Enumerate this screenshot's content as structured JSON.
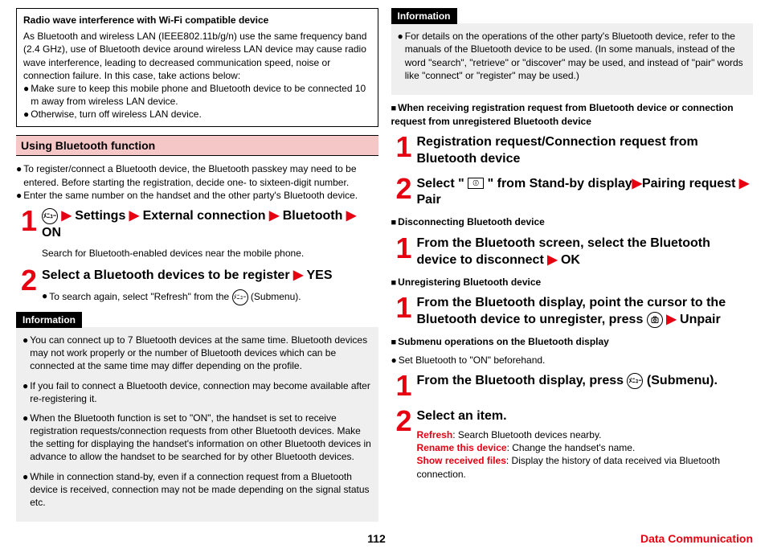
{
  "left": {
    "box": {
      "title": "Radio wave interference with Wi-Fi compatible device",
      "p1": "As Bluetooth and wireless LAN (IEEE802.11b/g/n) use the same frequency band (2.4 GHz), use of Bluetooth device around wireless LAN device may cause radio wave interference, leading to decreased communication speed, noise or connection failure. In this case, take actions below:",
      "b1": "Make sure to keep this mobile phone and Bluetooth device to be connected 10 m away from wireless LAN device.",
      "b2": "Otherwise, turn off wireless LAN device."
    },
    "section": "Using Bluetooth function",
    "pre1": "To register/connect a Bluetooth device, the Bluetooth passkey may need to be entered. Before starting the registration, decide one- to sixteen-digit number.",
    "pre2": "Enter the same number on the handset and the other party's Bluetooth device.",
    "step1": {
      "menu_icon": "ﾒﾆｭｰ",
      "a": "Settings",
      "b": "External connection",
      "c": "Bluetooth",
      "d": "ON",
      "note": "Search for Bluetooth-enabled devices near the mobile phone."
    },
    "step2": {
      "heading_a": "Select a Bluetooth devices to be register",
      "heading_b": "YES",
      "note": "To search again, select \"Refresh\" from the",
      "submenu_icon": "ﾒﾆｭｰ",
      "note_tail": "(Submenu)."
    },
    "info_label": "Information",
    "info": {
      "i1": "You can connect up to 7 Bluetooth devices at the same time. Bluetooth devices may not work properly or the number of Bluetooth devices which can be connected at the same time may differ depending on the profile.",
      "i2": "If you fail to connect a Bluetooth device, connection may become available after re-registering it.",
      "i3": "When the Bluetooth function is set to \"ON\", the handset is set to receive registration requests/connection requests from other Bluetooth devices. Make the setting for displaying the handset's information on other Bluetooth devices in advance to allow the handset to be searched for by other Bluetooth devices.",
      "i4": "While in connection stand-by, even if a connection request from a Bluetooth device is received, connection may not be made depending on the signal status etc."
    }
  },
  "right": {
    "info_label": "Information",
    "info1": "For details on the operations of the other party's Bluetooth device, refer to the manuals of the Bluetooth device to be used. (In some manuals, instead of the word \"search\", \"retrieve\" or \"discover\" may be used, and instead of \"pair\" words like \"connect\" or \"register\" may be used.)",
    "h1": "When receiving registration request from Bluetooth device or connection request from unregistered Bluetooth device",
    "step1": "Registration request/Connection request from Bluetooth device",
    "step2": {
      "pre": "Select \"",
      "icon": "ⓘ",
      "mid": "\" from Stand-by display",
      "a": "Pairing request",
      "b": "Pair"
    },
    "h2": "Disconnecting Bluetooth device",
    "step3": {
      "a": "From the Bluetooth screen, select the Bluetooth device to disconnect",
      "b": "OK"
    },
    "h3": "Unregistering Bluetooth device",
    "step4": {
      "a": "From the Bluetooth display, point the cursor to the Bluetooth device to unregister, press",
      "icon": "📷",
      "b": "Unpair"
    },
    "h4": "Submenu operations on the Bluetooth display",
    "pre4": "Set Bluetooth to \"ON\" beforehand.",
    "step5": {
      "a": "From the Bluetooth display, press",
      "icon": "ﾒﾆｭｰ",
      "b": "(Submenu)."
    },
    "step6": {
      "heading": "Select an item.",
      "r1_label": "Refresh",
      "r1_text": ": Search Bluetooth devices nearby.",
      "r2_label": "Rename this device",
      "r2_text": ": Change the handset's name.",
      "r3_label": "Show received files",
      "r3_text": ": Display the history of data received via Bluetooth connection."
    }
  },
  "footer": {
    "page": "112",
    "chapter": "Data Communication"
  }
}
